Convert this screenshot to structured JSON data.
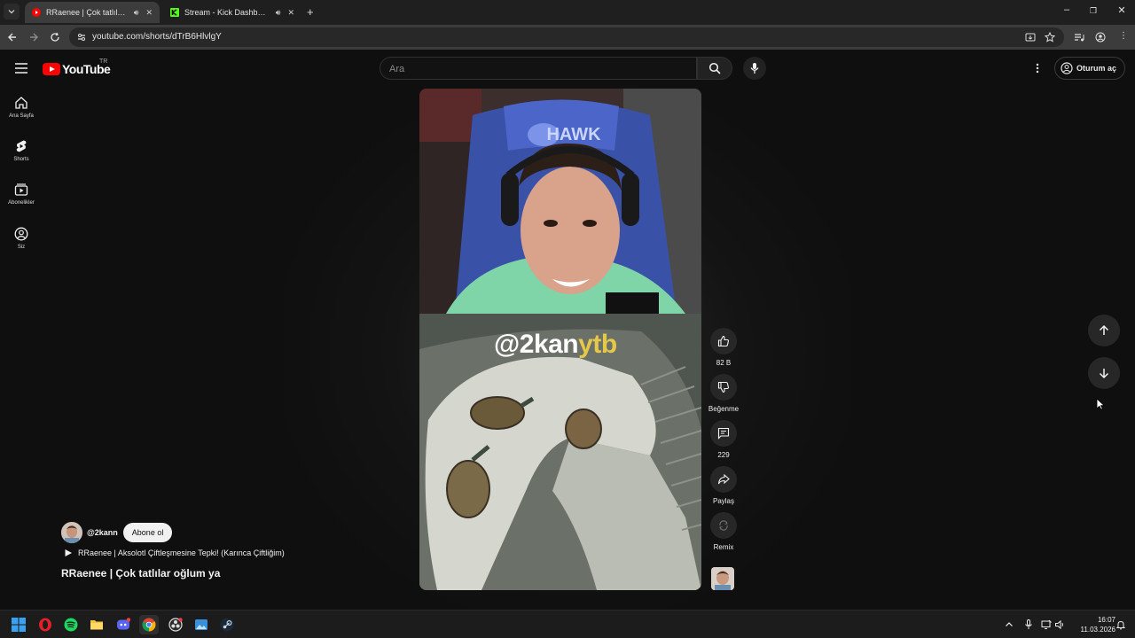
{
  "browser": {
    "tabs": [
      {
        "title": "RRaenee | Çok tatlılar oğlum ya - YouTube",
        "active": true
      },
      {
        "title": "Stream - Kick Dashboard",
        "active": false
      }
    ],
    "url": "youtube.com/shorts/dTrB6HlvlgY"
  },
  "youtube": {
    "logo_text": "YouTube",
    "country_code": "TR",
    "search_placeholder": "Ara",
    "signin_label": "Oturum aç",
    "sidebar": [
      {
        "label": "Ana Sayfa",
        "icon": "home-icon"
      },
      {
        "label": "Shorts",
        "icon": "shorts-icon"
      },
      {
        "label": "Abonelikler",
        "icon": "subscriptions-icon"
      },
      {
        "label": "Siz",
        "icon": "you-icon"
      }
    ],
    "short": {
      "watermark_a": "@2kan",
      "watermark_b": "ytb",
      "hawk_text": "HAWK",
      "channel_handle": "@2kann",
      "subscribe_label": "Abone ol",
      "related_video": "RRaenee | Aksolotl Çiftleşmesine Tepki! (Karınca Çiftliğim)",
      "title": "RRaenee | Çok tatlılar oğlum ya"
    },
    "actions": {
      "like_count": "82 B",
      "dislike_label": "Beğenme",
      "comment_count": "229",
      "share_label": "Paylaş",
      "remix_label": "Remix"
    }
  },
  "taskbar": {
    "apps": [
      "windows-start-icon",
      "opera-icon",
      "spotify-icon",
      "file-explorer-icon",
      "discord-icon",
      "chrome-icon",
      "obs-icon",
      "photos-icon",
      "steam-icon"
    ],
    "time": "16:07",
    "date": "11.03.2026"
  },
  "colors": {
    "brand_red": "#ff0000",
    "bg": "#0f0f0f",
    "watermark_yellow": "#e4c84a"
  }
}
